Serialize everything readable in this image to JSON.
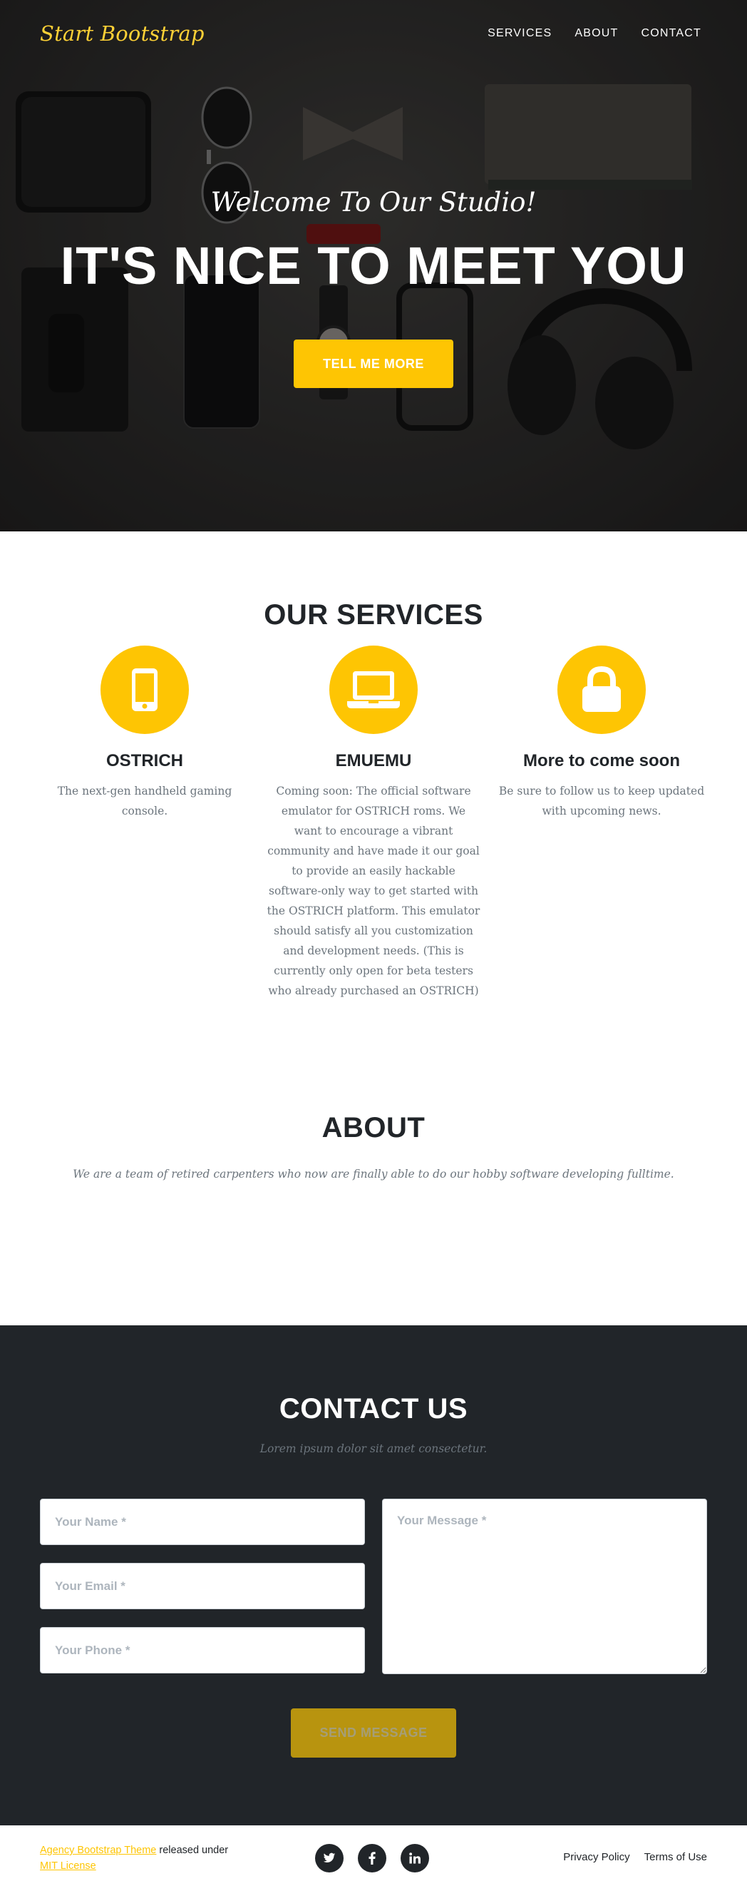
{
  "nav": {
    "brand": "Start Bootstrap",
    "links": [
      "SERVICES",
      "ABOUT",
      "CONTACT"
    ]
  },
  "hero": {
    "subheading": "Welcome To Our Studio!",
    "heading": "IT'S NICE TO MEET YOU",
    "button": "TELL ME MORE"
  },
  "services": {
    "heading": "OUR SERVICES",
    "items": [
      {
        "icon": "mobile-phone-icon",
        "title": "OSTRICH",
        "text": "The next-gen handheld gaming console."
      },
      {
        "icon": "laptop-icon",
        "title": "EMUEMU",
        "text": "Coming soon: The official software emulator for OSTRICH roms. We want to encourage a vibrant community and have made it our goal to provide an easily hackable software-only way to get started with the OSTRICH platform. This emulator should satisfy all you customization and development needs. (This is currently only open for beta testers who already purchased an OSTRICH)"
      },
      {
        "icon": "lock-icon",
        "title": "More to come soon",
        "text": "Be sure to follow us to keep updated with upcoming news."
      }
    ]
  },
  "about": {
    "heading": "ABOUT",
    "text": "We are a team of retired carpenters who now are finally able to do our hobby software developing fulltime."
  },
  "contact": {
    "heading": "CONTACT US",
    "subheading": "Lorem ipsum dolor sit amet consectetur.",
    "name_placeholder": "Your Name *",
    "email_placeholder": "Your Email *",
    "phone_placeholder": "Your Phone *",
    "message_placeholder": "Your Message *",
    "button": "SEND MESSAGE"
  },
  "footer": {
    "theme_link": "Agency Bootstrap Theme",
    "released_text": " released under",
    "license_link": "MIT License",
    "social_icons": [
      "twitter-icon",
      "facebook-icon",
      "linkedin-icon"
    ],
    "links": [
      "Privacy Policy",
      "Terms of Use"
    ]
  },
  "colors": {
    "accent": "#fec503",
    "dark": "#212529",
    "muted": "#6c757d"
  }
}
